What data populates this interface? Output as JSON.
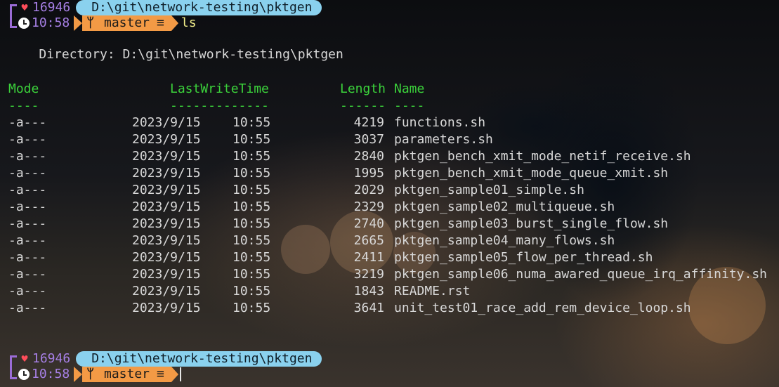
{
  "prompt": {
    "uptime": "16946",
    "path": "D:\\git\\network-testing\\pktgen",
    "time": "10:58",
    "branch": "master",
    "branch_status": "≡",
    "command": "ls"
  },
  "directory_line": "    Directory: D:\\git\\network-testing\\pktgen",
  "headers": {
    "mode": "Mode",
    "lastwrite": "LastWriteTime",
    "length": "Length",
    "name": "Name"
  },
  "underlines": {
    "mode": "----",
    "lastwrite": "-------------",
    "length": "------",
    "name": "----"
  },
  "files": [
    {
      "mode": "-a---",
      "date": "2023/9/15",
      "time": "10:55",
      "length": "4219",
      "name": "functions.sh"
    },
    {
      "mode": "-a---",
      "date": "2023/9/15",
      "time": "10:55",
      "length": "3037",
      "name": "parameters.sh"
    },
    {
      "mode": "-a---",
      "date": "2023/9/15",
      "time": "10:55",
      "length": "2840",
      "name": "pktgen_bench_xmit_mode_netif_receive.sh"
    },
    {
      "mode": "-a---",
      "date": "2023/9/15",
      "time": "10:55",
      "length": "1995",
      "name": "pktgen_bench_xmit_mode_queue_xmit.sh"
    },
    {
      "mode": "-a---",
      "date": "2023/9/15",
      "time": "10:55",
      "length": "2029",
      "name": "pktgen_sample01_simple.sh"
    },
    {
      "mode": "-a---",
      "date": "2023/9/15",
      "time": "10:55",
      "length": "2329",
      "name": "pktgen_sample02_multiqueue.sh"
    },
    {
      "mode": "-a---",
      "date": "2023/9/15",
      "time": "10:55",
      "length": "2740",
      "name": "pktgen_sample03_burst_single_flow.sh"
    },
    {
      "mode": "-a---",
      "date": "2023/9/15",
      "time": "10:55",
      "length": "2665",
      "name": "pktgen_sample04_many_flows.sh"
    },
    {
      "mode": "-a---",
      "date": "2023/9/15",
      "time": "10:55",
      "length": "2411",
      "name": "pktgen_sample05_flow_per_thread.sh"
    },
    {
      "mode": "-a---",
      "date": "2023/9/15",
      "time": "10:55",
      "length": "3219",
      "name": "pktgen_sample06_numa_awared_queue_irq_affinity.sh"
    },
    {
      "mode": "-a---",
      "date": "2023/9/15",
      "time": "10:55",
      "length": "1843",
      "name": "README.rst"
    },
    {
      "mode": "-a---",
      "date": "2023/9/15",
      "time": "10:55",
      "length": "3641",
      "name": "unit_test01_race_add_rem_device_loop.sh"
    }
  ],
  "colors": {
    "header_green": "#3bd23b",
    "path_bg": "#8ad1ee",
    "git_bg": "#f39a45",
    "uptime": "#a780e6",
    "command": "#f2ee8a"
  }
}
